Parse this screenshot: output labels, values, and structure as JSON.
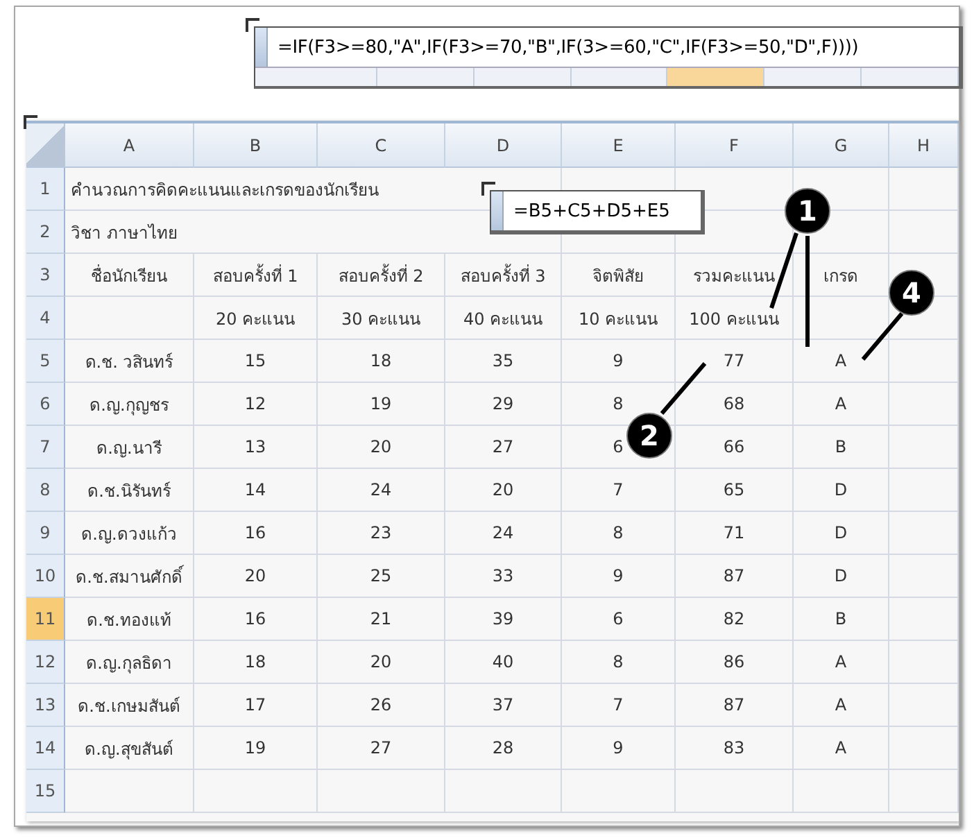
{
  "formula_popups": [
    {
      "formula": "=IF(F3>=80,\"A\",IF(F3>=70,\"B\",IF(3>=60,\"C\",IF(F3>=50,\"D\",F))))",
      "strip": [
        {
          "selected": false
        },
        {
          "selected": false
        },
        {
          "selected": false
        },
        {
          "selected": false
        },
        {
          "selected": true
        },
        {
          "selected": false
        },
        {
          "selected": false
        }
      ]
    },
    {
      "formula": "=B5+C5+D5+E5"
    }
  ],
  "sheet": {
    "columns": [
      "A",
      "B",
      "C",
      "D",
      "E",
      "F",
      "G",
      "H"
    ],
    "rows": [
      {
        "number": "1",
        "selected": false,
        "kind": "title",
        "cells": [
          "คำนวณการคิดคะแนนและเกรดของนักเรียน"
        ]
      },
      {
        "number": "2",
        "selected": false,
        "kind": "title",
        "cells": [
          "วิชา ภาษาไทย"
        ]
      },
      {
        "number": "3",
        "selected": false,
        "kind": "data",
        "cells": [
          "ชื่อนักเรียน",
          "สอบครั้งที่ 1",
          "สอบครั้งที่ 2",
          "สอบครั้งที่ 3",
          "จิตพิสัย",
          "รวมคะแนน",
          "เกรด"
        ]
      },
      {
        "number": "4",
        "selected": false,
        "kind": "data",
        "cells": [
          "",
          "20 คะแนน",
          "30 คะแนน",
          "40 คะแนน",
          "10 คะแนน",
          "100 คะแนน"
        ]
      },
      {
        "number": "5",
        "selected": false,
        "kind": "data",
        "cells": [
          "ด.ช. วสินทร์",
          "15",
          "18",
          "35",
          "9",
          "77",
          "A"
        ]
      },
      {
        "number": "6",
        "selected": false,
        "kind": "data",
        "cells": [
          "ด.ญ.กุญชร",
          "12",
          "19",
          "29",
          "8",
          "68",
          "A"
        ]
      },
      {
        "number": "7",
        "selected": false,
        "kind": "data",
        "cells": [
          "ด.ญ.นารี",
          "13",
          "20",
          "27",
          "6",
          "66",
          "B"
        ]
      },
      {
        "number": "8",
        "selected": false,
        "kind": "data",
        "cells": [
          "ด.ช.นิรันทร์",
          "14",
          "24",
          "20",
          "7",
          "65",
          "D"
        ]
      },
      {
        "number": "9",
        "selected": false,
        "kind": "data",
        "cells": [
          "ด.ญ.ดวงแก้ว",
          "16",
          "23",
          "24",
          "8",
          "71",
          "D"
        ]
      },
      {
        "number": "10",
        "selected": false,
        "kind": "data",
        "cells": [
          "ด.ช.สมานศักดิ์",
          "20",
          "25",
          "33",
          "9",
          "87",
          "D"
        ]
      },
      {
        "number": "11",
        "selected": true,
        "kind": "data",
        "cells": [
          "ด.ช.ทองแท้",
          "16",
          "21",
          "39",
          "6",
          "82",
          "B"
        ]
      },
      {
        "number": "12",
        "selected": false,
        "kind": "data",
        "cells": [
          "ด.ญ.กุลธิดา",
          "18",
          "20",
          "40",
          "8",
          "86",
          "A"
        ]
      },
      {
        "number": "13",
        "selected": false,
        "kind": "data",
        "cells": [
          "ด.ช.เกษมสันต์",
          "17",
          "26",
          "37",
          "7",
          "87",
          "A"
        ]
      },
      {
        "number": "14",
        "selected": false,
        "kind": "data",
        "cells": [
          "ด.ญ.สุขสันต์",
          "19",
          "27",
          "28",
          "9",
          "83",
          "A"
        ]
      },
      {
        "number": "15",
        "selected": false,
        "kind": "data",
        "cells": []
      }
    ]
  },
  "callouts": [
    {
      "label": "1"
    },
    {
      "label": "2"
    },
    {
      "label": "4"
    }
  ]
}
